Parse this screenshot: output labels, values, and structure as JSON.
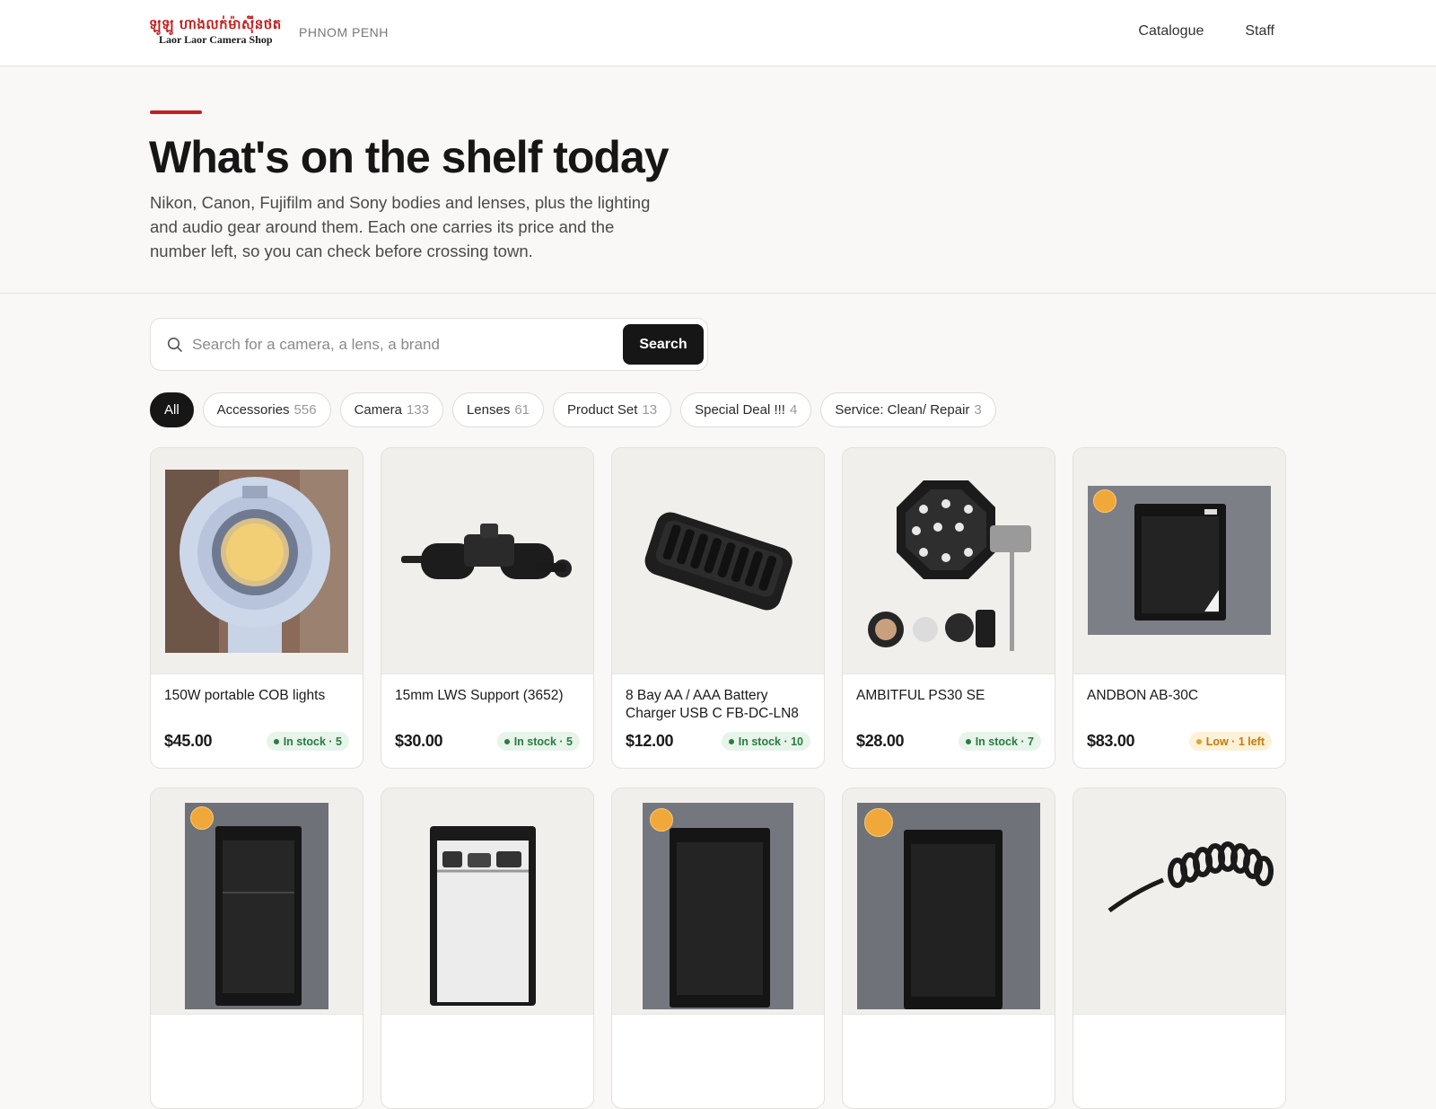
{
  "header": {
    "logo_khmer": "ឡូឡូ ហាងលក់ម៉ាស៊ីនថត",
    "logo_english": "Laor Laor Camera Shop",
    "city": "PHNOM PENH",
    "nav": [
      "Catalogue",
      "Staff"
    ]
  },
  "hero": {
    "title": "What's on the shelf today",
    "subtitle": "Nikon, Canon, Fujifilm and Sony bodies and lenses, plus the lighting and audio gear around them. Each one carries its price and the number left, so you can check before crossing town."
  },
  "search": {
    "placeholder": "Search for a camera, a lens, a brand",
    "button_label": "Search",
    "icon": "search-icon"
  },
  "filters": [
    {
      "label": "All",
      "count": "",
      "active": true
    },
    {
      "label": "Accessories",
      "count": "556",
      "active": false
    },
    {
      "label": "Camera",
      "count": "133",
      "active": false
    },
    {
      "label": "Lenses",
      "count": "61",
      "active": false
    },
    {
      "label": "Product Set",
      "count": "13",
      "active": false
    },
    {
      "label": "Special Deal !!!",
      "count": "4",
      "active": false
    },
    {
      "label": "Service: Clean/ Repair",
      "count": "3",
      "active": false
    }
  ],
  "products": [
    {
      "name": "150W portable COB lights",
      "price": "$45.00",
      "stock": "In stock · 5",
      "status": "in",
      "image": "cob-light"
    },
    {
      "name": "15mm LWS Support (3652)",
      "price": "$30.00",
      "stock": "In stock · 5",
      "status": "in",
      "image": "rod-clamp"
    },
    {
      "name": "8 Bay AA / AAA Battery Charger USB C FB-DC-LN8",
      "price": "$12.00",
      "stock": "In stock · 10",
      "status": "in",
      "image": "battery-charger"
    },
    {
      "name": "AMBITFUL PS30 SE",
      "price": "$28.00",
      "stock": "In stock · 7",
      "status": "in",
      "image": "softbox"
    },
    {
      "name": "ANDBON AB-30C",
      "price": "$83.00",
      "stock": "Low · 1 left",
      "status": "low",
      "image": "dry-cabinet"
    },
    {
      "name": "",
      "price": "",
      "stock": "",
      "status": "",
      "image": "dry-cabinet"
    },
    {
      "name": "",
      "price": "",
      "stock": "",
      "status": "",
      "image": "dry-cabinet-open"
    },
    {
      "name": "",
      "price": "",
      "stock": "",
      "status": "",
      "image": "dry-cabinet"
    },
    {
      "name": "",
      "price": "",
      "stock": "",
      "status": "",
      "image": "dry-cabinet"
    },
    {
      "name": "",
      "price": "",
      "stock": "",
      "status": "",
      "image": "coiled-cable"
    }
  ],
  "colors": {
    "brand_red": "#c41e1e",
    "dark": "#161616",
    "in_stock_green": "#2b7a43",
    "low_stock_amber": "#c07c0a",
    "page_bg": "#f9f8f6"
  }
}
